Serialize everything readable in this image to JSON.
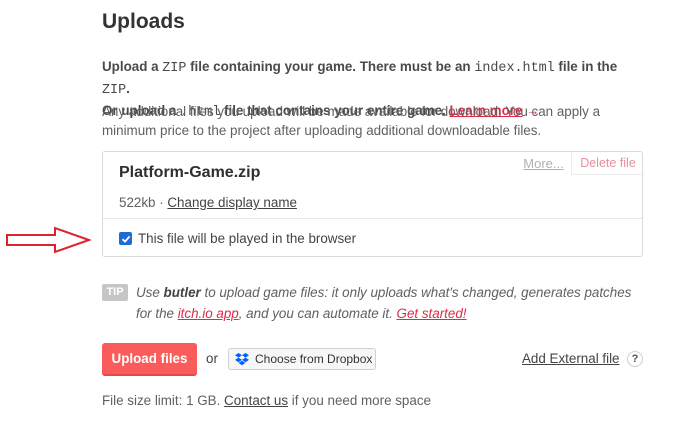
{
  "section": {
    "title": "Uploads"
  },
  "intro": {
    "p1": "Upload a ",
    "code1": "ZIP",
    "p2": " file containing your game. There must be an ",
    "code2": "index.html",
    "p3": " file in the ",
    "code3": "ZIP",
    "p4": ".",
    "p5": "Or upload a ",
    "code4": ".html",
    "p6": " file that contains your entire game. ",
    "learn_more": "Learn more",
    "arrow": "→"
  },
  "note": "Any additional files you upload will be made available for download. You can apply a minimum price to the project after uploading additional downloadable files.",
  "file": {
    "name": "Platform-Game.zip",
    "size": "522kb",
    "separator": " · ",
    "change_name": "Change display name",
    "more": "More...",
    "delete": "Delete file",
    "play_in_browser_label": "This file will be played in the browser",
    "play_in_browser_checked": true
  },
  "tip": {
    "badge": "TIP",
    "use": "Use ",
    "butler": "butler",
    "rest1": " to upload game files: it only uploads what's changed, generates patches for the ",
    "itch_app": "itch.io app",
    "rest2": ", and you can automate it. ",
    "get_started": "Get started!"
  },
  "actions": {
    "upload": "Upload files",
    "or": "or",
    "dropbox": "Choose from Dropbox",
    "external": "Add External file",
    "help": "?"
  },
  "footer": {
    "limit": "File size limit: 1 GB. ",
    "contact": "Contact us",
    "rest": " if you need more space"
  },
  "colors": {
    "accent": "#fa5c5c",
    "link": "#da2c49",
    "checkbox": "#1e6bd6",
    "arrow": "#e0222e"
  }
}
